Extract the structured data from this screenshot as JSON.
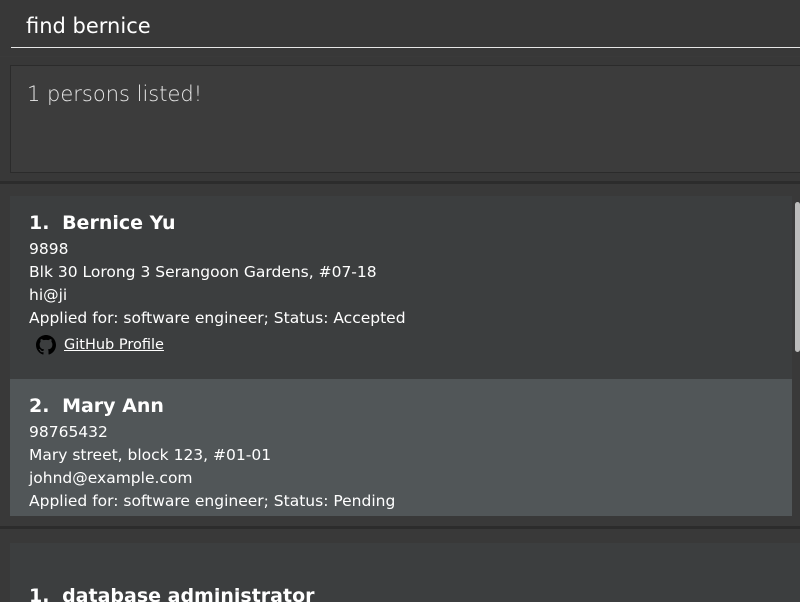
{
  "command_box": {
    "value": "find bernice"
  },
  "result_display": {
    "text": "1 persons listed!"
  },
  "persons": [
    {
      "index": "1.",
      "name": "Bernice Yu",
      "phone": "9898",
      "address": "Blk 30 Lorong 3 Serangoon Gardens, #07-18",
      "email": "hi@ji",
      "application": "Applied for: software engineer; Status: Accepted",
      "github_label": "GitHub Profile"
    },
    {
      "index": "2.",
      "name": "Mary Ann",
      "phone": "98765432",
      "address": "Mary street, block 123, #01-01",
      "email": "johnd@example.com",
      "application": "Applied for: software engineer; Status: Pending"
    }
  ],
  "jobs": [
    {
      "index": "1.",
      "title": "database administrator"
    }
  ],
  "colors": {
    "background": "#3a3a3a",
    "card_odd": "#3c3e3f",
    "card_even": "#515658",
    "text": "#ffffff"
  },
  "icons": {
    "github": "github-icon"
  }
}
